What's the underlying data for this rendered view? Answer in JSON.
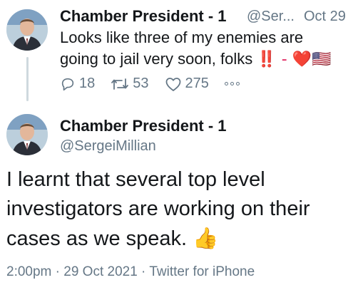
{
  "tweet1": {
    "display_name": "Chamber President - 1",
    "handle_truncated": "@Ser...",
    "date": "Oct 29",
    "text_line1": "Looks like three of my enemies are",
    "text_line2": "going to jail very soon, folks",
    "text_suffix": "‼️ - ❤️🇺🇸",
    "replies": "18",
    "retweets": "53",
    "likes": "275"
  },
  "tweet2": {
    "display_name": "Chamber President - 1",
    "handle": "@SergeiMillian",
    "text_line1": "I learnt that several top level",
    "text_line2": "investigators are working on their",
    "text_line3": "cases as we speak.",
    "emoji": "👍",
    "footer": "2:00pm · 29 Oct 2021 · Twitter for iPhone"
  },
  "colors": {
    "text": "#14171a",
    "muted": "#657786",
    "thread_line": "#cfd9de"
  }
}
